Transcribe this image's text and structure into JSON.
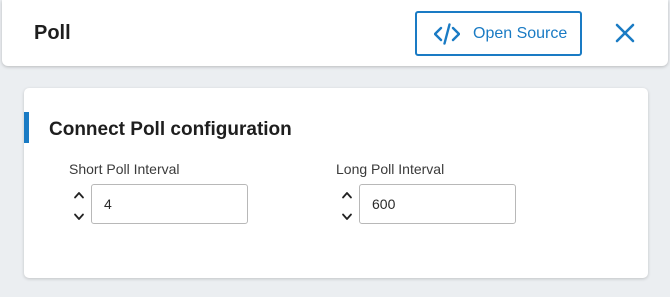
{
  "header": {
    "title": "Poll",
    "open_source_label": "Open Source",
    "open_source_icon": "code-icon",
    "close_icon": "close-icon",
    "accent_color": "#1a7bc4"
  },
  "card": {
    "title": "Connect Poll configuration",
    "fields": [
      {
        "label": "Short Poll Interval",
        "value": "4"
      },
      {
        "label": "Long Poll Interval",
        "value": "600"
      }
    ]
  }
}
